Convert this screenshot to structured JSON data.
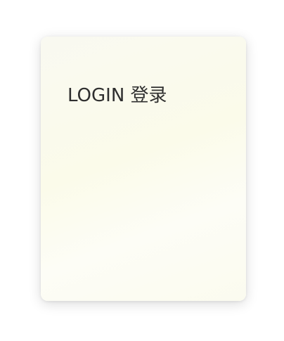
{
  "login_card": {
    "title": "LOGIN 登录"
  }
}
